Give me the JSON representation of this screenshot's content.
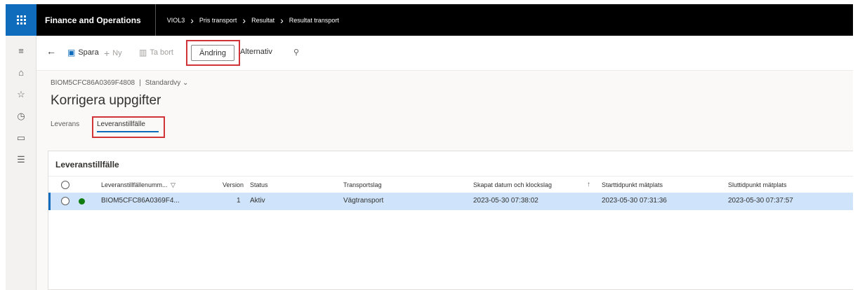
{
  "topbar": {
    "app_title": "Finance and Operations",
    "breadcrumb": [
      "VIOL3",
      "Pris transport",
      "Resultat",
      "Resultat transport"
    ]
  },
  "actions": {
    "save": "Spara",
    "new": "Ny",
    "delete": "Ta bort",
    "change": "Ändring",
    "options": "Alternativ"
  },
  "header": {
    "record_id": "BIOM5CFC86A0369F4808",
    "view": "Standardvy",
    "title": "Korrigera uppgifter"
  },
  "tabs": [
    {
      "label": "Leverans"
    },
    {
      "label": "Leveranstillfälle"
    }
  ],
  "grid": {
    "title": "Leveranstillfälle",
    "columns": [
      "Leveranstillfällenumm...",
      "Version",
      "Status",
      "Transportslag",
      "Skapat datum och klockslag",
      "Starttidpunkt mätplats",
      "Sluttidpunkt mätplats"
    ],
    "rows": [
      {
        "number": "BIOM5CFC86A0369F4...",
        "version": "1",
        "status": "Aktiv",
        "transport": "Vägtransport",
        "created": "2023-05-30 07:38:02",
        "start": "2023-05-30 07:31:36",
        "end": "2023-05-30 07:37:57"
      }
    ]
  },
  "colors": {
    "accent": "#0f6cbd",
    "highlight": "#d13438",
    "status_active": "#107c10",
    "row_selected": "#cfe4fa"
  }
}
